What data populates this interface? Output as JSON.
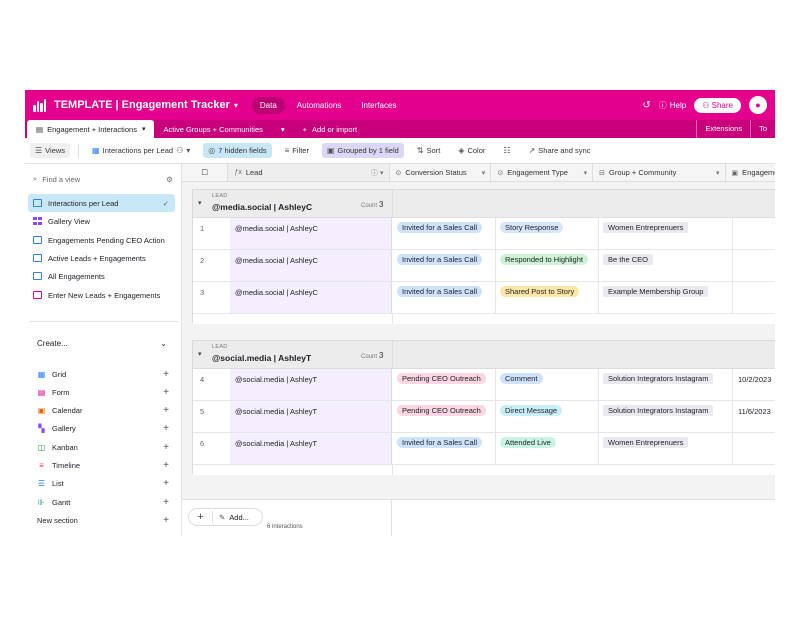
{
  "app": {
    "title": "TEMPLATE | Engagement Tracker",
    "nav": [
      "Data",
      "Automations",
      "Interfaces"
    ],
    "help_label": "Help",
    "share_label": "Share"
  },
  "tables": {
    "active": "Engagement + Interactions",
    "other": "Active Groups + Communities",
    "add": "Add or import",
    "extensions": "Extensions",
    "tools": "To"
  },
  "viewbar": {
    "views_label": "Views",
    "current_view": "Interactions per Lead",
    "hidden_fields": "7 hidden fields",
    "filter": "Filter",
    "grouped": "Grouped by 1 field",
    "sort": "Sort",
    "color": "Color",
    "share_sync": "Share and sync"
  },
  "sidebar": {
    "find_placeholder": "Find a view",
    "views": [
      {
        "label": "Interactions per Lead",
        "active": true
      },
      {
        "label": "Gallery View"
      },
      {
        "label": "Engagements Pending CEO Action"
      },
      {
        "label": "Active Leads + Engagements"
      },
      {
        "label": "All Engagements"
      },
      {
        "label": "Enter New Leads + Engagements"
      }
    ],
    "create_label": "Create...",
    "create_items": [
      {
        "label": "Grid"
      },
      {
        "label": "Form"
      },
      {
        "label": "Calendar"
      },
      {
        "label": "Gallery"
      },
      {
        "label": "Kanban"
      },
      {
        "label": "Timeline"
      },
      {
        "label": "List"
      },
      {
        "label": "Gantt"
      }
    ],
    "new_section": "New section"
  },
  "grid": {
    "columns": [
      "Lead",
      "Conversion Status",
      "Engagement Type",
      "Group + Community",
      "Engageme"
    ],
    "group_label": "LEAD",
    "count_label": "Count",
    "groups": [
      {
        "title": "@media.social | AshleyC",
        "count": "3",
        "rows": [
          {
            "num": "1",
            "lead": "@media.social | AshleyC",
            "status": "Invited for a Sales Call",
            "type": "Story Response",
            "group": "Women Entreprenuers",
            "date": ""
          },
          {
            "num": "2",
            "lead": "@media.social | AshleyC",
            "status": "Invited for a Sales Call",
            "type": "Responded to Highlight",
            "group": "Be the CEO",
            "date": ""
          },
          {
            "num": "3",
            "lead": "@media.social | AshleyC",
            "status": "Invited for a Sales Call",
            "type": "Shared Post to Story",
            "group": "Example Membership Group",
            "date": ""
          }
        ]
      },
      {
        "title": "@social.media | AshleyT",
        "count": "3",
        "rows": [
          {
            "num": "4",
            "lead": "@social.media | AshleyT",
            "status": "Pending CEO Outreach",
            "type": "Comment",
            "group": "Solution Integrators Instagram",
            "date": "10/2/2023"
          },
          {
            "num": "5",
            "lead": "@social.media | AshleyT",
            "status": "Pending CEO Outreach",
            "type": "Direct Message",
            "group": "Solution Integrators Instagram",
            "date": "11/6/2023"
          },
          {
            "num": "6",
            "lead": "@social.media | AshleyT",
            "status": "Invited for a Sales Call",
            "type": "Attended Live",
            "group": "Women Entreprenuers",
            "date": ""
          }
        ]
      }
    ],
    "add_label": "Add...",
    "record_count": "6 interactions"
  },
  "colors": {
    "brand": "#e4008d",
    "pill_status_invited": "#cfe2fb",
    "pill_status_pending": "#fcd6e3",
    "pill_type_story": "#d6e5fb",
    "pill_type_highlight": "#cdf2d5",
    "pill_type_shared": "#fde7a6",
    "pill_type_comment": "#cfe2fb",
    "pill_type_dm": "#c9eef7",
    "pill_type_live": "#c9f3e4",
    "pill_group": "#e9e9ee"
  }
}
